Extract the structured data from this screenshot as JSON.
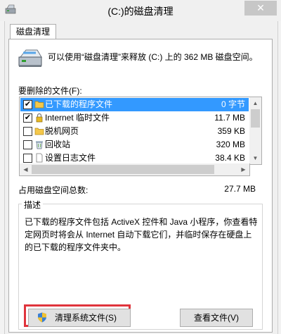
{
  "window": {
    "title": "(C:)的磁盘清理",
    "close_glyph": "✕"
  },
  "tab": {
    "label": "磁盘清理"
  },
  "summary": "可以使用“磁盘清理”来释放 (C:) 上的 362 MB 磁盘空间。",
  "files_label": "要删除的文件(F):",
  "files": [
    {
      "name": "已下载的程序文件",
      "size": "0 字节",
      "checked": true,
      "selected": true,
      "icon": "folder-icon"
    },
    {
      "name": "Internet 临时文件",
      "size": "11.7 MB",
      "checked": true,
      "selected": false,
      "icon": "lock-icon"
    },
    {
      "name": "脱机网页",
      "size": "359 KB",
      "checked": false,
      "selected": false,
      "icon": "folder-icon"
    },
    {
      "name": "回收站",
      "size": "320 MB",
      "checked": false,
      "selected": false,
      "icon": "recycle-bin-icon"
    },
    {
      "name": "设置日志文件",
      "size": "38.4 KB",
      "checked": false,
      "selected": false,
      "icon": "document-icon"
    }
  ],
  "total": {
    "label": "占用磁盘空间总数:",
    "value": "27.7 MB"
  },
  "description": {
    "title": "描述",
    "text": "已下载的程序文件包括 ActiveX 控件和 Java 小程序，你查看特定网页时将会从 Internet 自动下载它们，并临时保存在硬盘上的已下载的程序文件夹中。"
  },
  "buttons": {
    "clean_system": "清理系统文件(S)",
    "view_files": "查看文件(V)"
  },
  "colors": {
    "selection": "#3399ff",
    "highlight_frame": "#e0343c"
  }
}
